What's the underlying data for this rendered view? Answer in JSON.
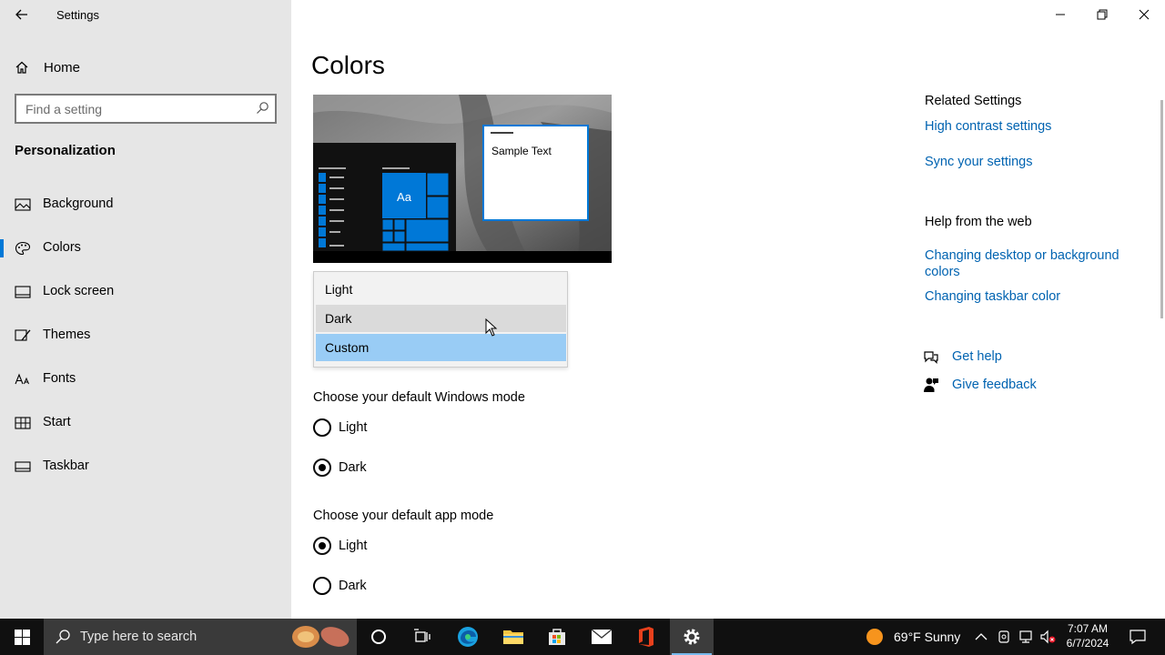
{
  "window": {
    "title": "Settings"
  },
  "sidebar": {
    "home_label": "Home",
    "search_placeholder": "Find a setting",
    "section_title": "Personalization",
    "items": [
      {
        "label": "Background",
        "icon": "picture-icon"
      },
      {
        "label": "Colors",
        "icon": "palette-icon",
        "selected": true
      },
      {
        "label": "Lock screen",
        "icon": "lock-screen-icon"
      },
      {
        "label": "Themes",
        "icon": "brush-icon"
      },
      {
        "label": "Fonts",
        "icon": "fonts-icon"
      },
      {
        "label": "Start",
        "icon": "start-icon"
      },
      {
        "label": "Taskbar",
        "icon": "taskbar-icon"
      }
    ]
  },
  "main": {
    "title": "Colors",
    "preview": {
      "sample_text": "Sample Text",
      "tile_text": "Aa"
    },
    "dropdown": {
      "options": [
        "Light",
        "Dark",
        "Custom"
      ],
      "hovered": "Dark",
      "selected": "Custom"
    },
    "windows_mode": {
      "label": "Choose your default Windows mode",
      "options": [
        "Light",
        "Dark"
      ],
      "selected": "Dark"
    },
    "app_mode": {
      "label": "Choose your default app mode",
      "options": [
        "Light",
        "Dark"
      ],
      "selected": "Light"
    }
  },
  "related": {
    "title": "Related Settings",
    "links": [
      "High contrast settings",
      "Sync your settings"
    ],
    "help_title": "Help from the web",
    "help_links": [
      "Changing desktop or background colors",
      "Changing taskbar color"
    ],
    "get_help": "Get help",
    "give_feedback": "Give feedback"
  },
  "taskbar": {
    "search_placeholder": "Type here to search",
    "weather": "69°F  Sunny",
    "time": "7:07 AM",
    "date": "6/7/2024"
  },
  "colors": {
    "accent": "#0078d7",
    "link": "#0063b1",
    "sidebar_bg": "#e6e6e6",
    "taskbar_bg": "#101010",
    "dropdown_selected": "#99ccf5"
  }
}
